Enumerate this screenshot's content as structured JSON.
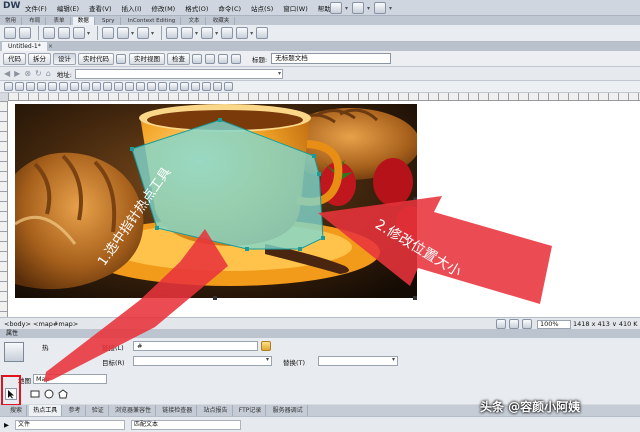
{
  "app": {
    "logo": "DW",
    "menus": [
      "文件(F)",
      "编辑(E)",
      "查看(V)",
      "插入(I)",
      "修改(M)",
      "格式(O)",
      "命令(C)",
      "站点(S)",
      "窗口(W)",
      "帮助(H)"
    ],
    "insert_tabs": [
      "常用",
      "布局",
      "表单",
      "数据",
      "Spry",
      "InContext Editing",
      "文本",
      "收藏夹"
    ],
    "active_insert_tab": "数据"
  },
  "document": {
    "tab_title": "Untitled-1*",
    "close_glyph": "×",
    "view_buttons": [
      "代码",
      "拆分",
      "设计",
      "实时代码",
      "实时视图",
      "检查"
    ],
    "title_label": "标题:",
    "title_value": "无标题文档",
    "address_label": "地址:",
    "address_value": ""
  },
  "status": {
    "tag_selector": "<body> <map#map>",
    "zoom": "100%",
    "dimensions": "1418 x 413 ∨ 410 K"
  },
  "properties": {
    "header": "属性",
    "hotspot_label": "热",
    "link_label": "链接(L)",
    "link_value": "#",
    "target_label": "目标(R)",
    "target_value": "",
    "replace_label": "替换(T)",
    "replace_value": "",
    "map_label": "地图",
    "map_value": "Map"
  },
  "bottom_panel": {
    "tabs": [
      "搜索",
      "热点工具",
      "参考",
      "验证",
      "浏览器兼容性",
      "链接检查器",
      "站点报告",
      "FTP记录",
      "服务器调试"
    ],
    "active_tab": "热点工具",
    "files_label": "文件",
    "match_label": "匹配文本"
  },
  "annotations": {
    "step1": "1.选中指针热点工具",
    "step2": "2.修改位置大小",
    "arrow_color": "#e8333b",
    "highlight_color": "#e0141e"
  },
  "watermark": "头条 @容颜小阿姨",
  "hotspot": {
    "fill": "#7fd8d0",
    "handle_color": "#1a9d9a"
  }
}
